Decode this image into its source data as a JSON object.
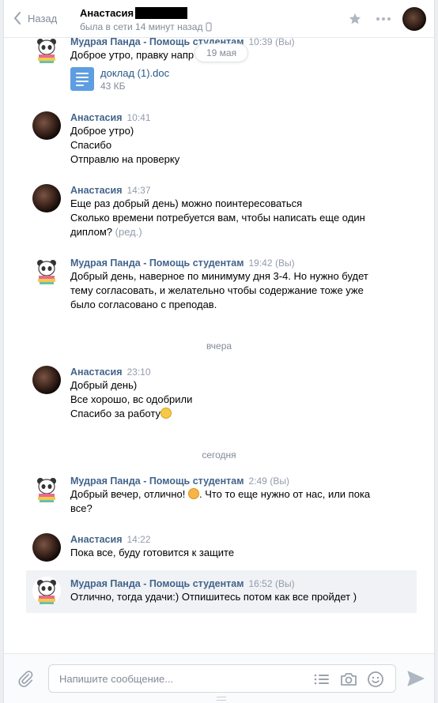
{
  "header": {
    "back_label": "Назад",
    "peer_name": "Анастасия",
    "peer_status": "была в сети 14 минут назад"
  },
  "messages": [
    {
      "author": "Мудрая Панда - Помощь студентам",
      "time": "10:39",
      "you": "(Вы)",
      "lines": [
        "Доброе утро, правку напр"
      ],
      "file": {
        "name": "доклад (1).doc",
        "size": "43 КБ"
      }
    },
    {
      "author": "Анастасия",
      "time": "10:41",
      "lines": [
        "Доброе утро)",
        "Спасибо",
        "Отправлю на проверку"
      ]
    },
    {
      "author": "Анастасия",
      "time": "14:37",
      "lines": [
        "Еще раз добрый день) можно поинтересоваться",
        "Сколько времени потребуется вам, чтобы написать еще один",
        "диплом?"
      ],
      "edited": "(ред.)"
    },
    {
      "author": "Мудрая Панда - Помощь студентам",
      "time": "19:42",
      "you": "(Вы)",
      "lines": [
        "Добрый день, наверное по минимуму дня 3-4. Но нужно будет",
        "тему согласовать, и желательно чтобы содержание тоже уже",
        "было согласовано с преподав."
      ]
    },
    {
      "author": "Анастасия",
      "time": "23:10",
      "lines": [
        "Добрый день)",
        "Все хорошо, вс одобрили",
        "Спасибо за работу"
      ]
    },
    {
      "author": "Мудрая Панда - Помощь студентам",
      "time": "2:49",
      "you": "(Вы)",
      "lines": [
        "Добрый вечер, отлично!",
        ". Что то еще нужно от нас, или пока",
        "все?"
      ]
    },
    {
      "author": "Анастасия",
      "time": "14:22",
      "lines": [
        "Пока все, буду готовится к защите"
      ]
    },
    {
      "author": "Мудрая Панда - Помощь студентам",
      "time": "16:52",
      "you": "(Вы)",
      "lines": [
        "Отлично, тогда удачи:) Отпишитесь потом как все пройдет )"
      ]
    }
  ],
  "dates": {
    "floating": "19 мая",
    "yesterday": "вчера",
    "today": "сегодня"
  },
  "composer": {
    "placeholder": "Напишите сообщение..."
  },
  "colors": {
    "author": "#42648b",
    "link": "#2a5885",
    "muted": "#828a99",
    "selected_bg": "#f0f2f5",
    "file_icon": "#5d9ee0"
  },
  "icons": [
    "back-arrow-icon",
    "phone-icon",
    "star-icon",
    "more-icon",
    "doc-file-icon",
    "paperclip-icon",
    "template-icon",
    "camera-icon",
    "smile-icon",
    "send-icon",
    "panda-avatar-icon",
    "eyes-emoji-icon",
    "love-emoji-icon"
  ]
}
